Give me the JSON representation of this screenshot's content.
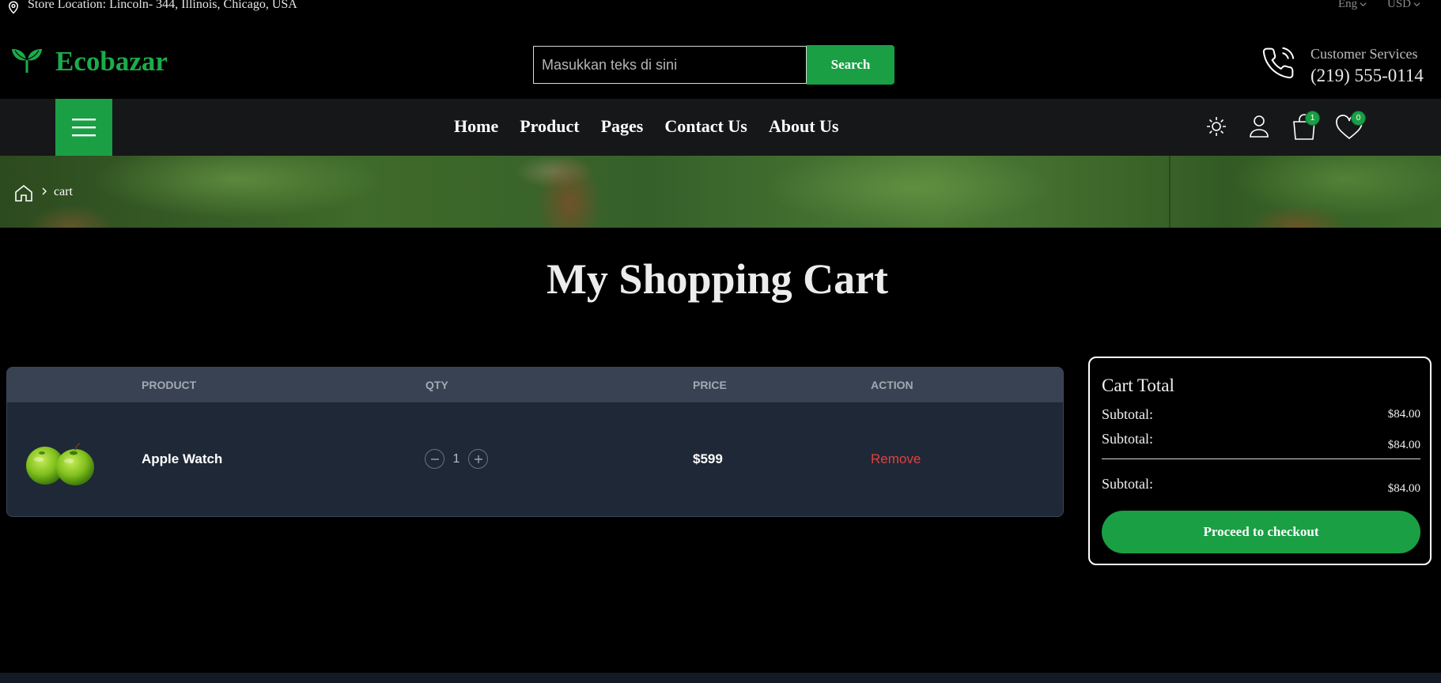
{
  "topbar": {
    "location": "Store Location: Lincoln- 344, Illinois, Chicago, USA",
    "language": "Eng",
    "currency": "USD"
  },
  "header": {
    "brand": "Ecobazar",
    "search_placeholder": "Masukkan teks di sini",
    "search_button": "Search",
    "customer_service_label": "Customer Services",
    "customer_service_phone": "(219) 555-0114"
  },
  "nav": {
    "links": [
      "Home",
      "Product",
      "Pages",
      "Contact Us",
      "About Us"
    ],
    "cart_count": "1",
    "wishlist_count": "0"
  },
  "breadcrumb": {
    "current": "cart"
  },
  "page_title": "My Shopping Cart",
  "cart_table": {
    "headers": [
      "PRODUCT",
      "QTY",
      "PRICE",
      "ACTION"
    ],
    "rows": [
      {
        "name": "Apple Watch",
        "qty": "1",
        "price": "$599",
        "action": "Remove"
      }
    ]
  },
  "cart_total": {
    "title": "Cart Total",
    "lines": [
      {
        "label": "Subtotal:",
        "value": "$84.00"
      },
      {
        "label": "Subtotal:",
        "value": "$84.00"
      },
      {
        "label": "Subtotal:",
        "value": "$84.00"
      }
    ],
    "checkout_button": "Proceed to checkout"
  },
  "colors": {
    "brand_green": "#1a9f45",
    "logo_green": "#1cab4b",
    "remove_red": "#e14040",
    "table_bg": "#1f2836",
    "table_header_bg": "#384252"
  }
}
